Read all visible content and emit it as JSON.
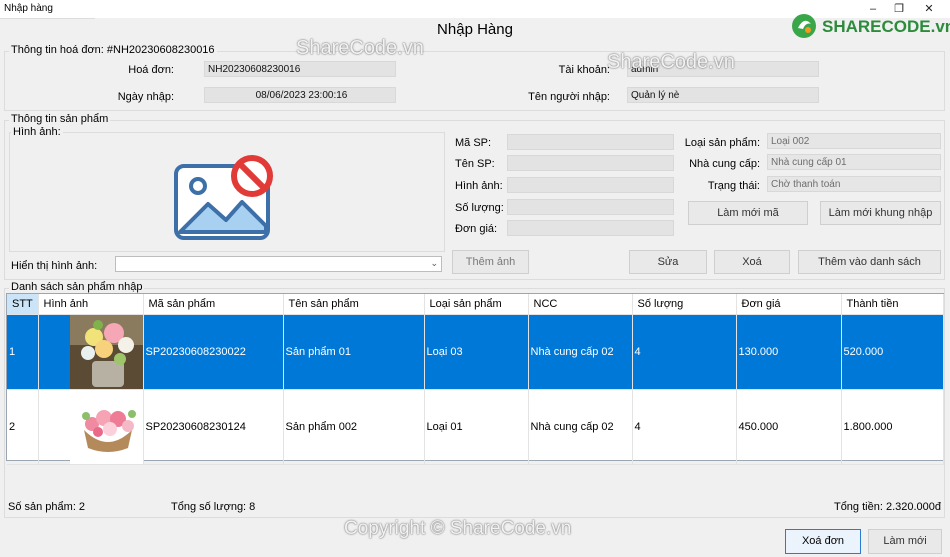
{
  "window": {
    "title": "Nhập hàng",
    "heading": "Nhập Hàng"
  },
  "watermark": {
    "text": "ShareCode.vn",
    "copyright": "Copyright © ShareCode.vn",
    "logo": "SHARECODE.vn"
  },
  "invoice": {
    "group_label": "Thông tin hoá đơn: #NH20230608230016",
    "invoice_label": "Hoá đơn:",
    "invoice_value": "NH20230608230016",
    "date_label": "Ngày nhập:",
    "date_value": "08/06/2023 23:00:16",
    "account_label": "Tài khoản:",
    "account_value": "admin",
    "importer_label": "Tên người nhập:",
    "importer_value": "Quản lý nè"
  },
  "product": {
    "group_label": "Thông tin sản phẩm",
    "image_group_label": "Hình ảnh:",
    "show_image_label": "Hiển thị hình ảnh:",
    "show_image_value": "",
    "code_label": "Mã SP:",
    "name_label": "Tên SP:",
    "image_label": "Hình ảnh:",
    "qty_label": "Số lượng:",
    "price_label": "Đơn giá:",
    "type_label": "Loại sản phẩm:",
    "type_value": "Loại 002",
    "supplier_label": "Nhà cung cấp:",
    "supplier_value": "Nhà cung cấp 01",
    "status_label": "Trạng thái:",
    "status_value": "Chờ thanh toán"
  },
  "buttons": {
    "refresh_code": "Làm mới mã",
    "refresh_form": "Làm mới khung nhập",
    "add_image": "Thêm ảnh",
    "edit": "Sửa",
    "delete": "Xoá",
    "add_to_list": "Thêm vào danh sách",
    "delete_invoice": "Xoá đơn",
    "reset": "Làm mới"
  },
  "list": {
    "group_label": "Danh sách sản phẩm nhập",
    "columns": [
      "STT",
      "Hình ảnh",
      "Mã sản phẩm",
      "Tên sản phẩm",
      "Loại sản phẩm",
      "NCC",
      "Số lượng",
      "Đơn giá",
      "Thành tiền"
    ],
    "rows": [
      {
        "stt": "1",
        "image": "flower-vase-photo",
        "code": "SP20230608230022",
        "name": "Sản phẩm 01",
        "type": "Loại 03",
        "ncc": "Nhà cung cấp 02",
        "qty": "4",
        "price": "130.000",
        "total": "520.000",
        "selected": true
      },
      {
        "stt": "2",
        "image": "flower-basket-photo",
        "code": "SP20230608230124",
        "name": "Sản phẩm 002",
        "type": "Loại 01",
        "ncc": "Nhà cung cấp 02",
        "qty": "4",
        "price": "450.000",
        "total": "1.800.000",
        "selected": false
      }
    ]
  },
  "footer": {
    "product_count": "Số sản phẩm: 2",
    "total_qty": "Tổng số lượng: 8",
    "total_amount": "Tổng tiền: 2.320.000đ"
  },
  "colors": {
    "selection": "#0078d7",
    "accent_button": "#2a7bd4"
  },
  "icons": {
    "no_image": "image-placeholder-forbidden-icon",
    "dropdown": "chevron-down-icon"
  }
}
